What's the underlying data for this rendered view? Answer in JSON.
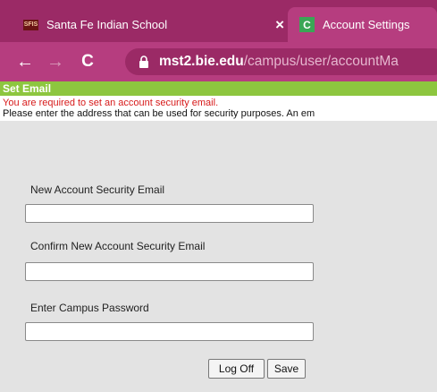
{
  "browser": {
    "tabs": [
      {
        "favicon_text": "SFIS",
        "title": "Santa Fe Indian School",
        "close_glyph": "×"
      },
      {
        "favicon_text": "C",
        "title": "Account Settings"
      }
    ],
    "nav": {
      "back_icon": "←",
      "forward_icon": "→",
      "reload_icon": "C"
    },
    "url_host": "mst2.bie.edu",
    "url_path": "/campus/user/accountMa"
  },
  "page": {
    "header": "Set Email",
    "error_message": "You are required to set an account security email.",
    "info_message": "Please enter the address that can be used for security purposes. An em",
    "fields": [
      {
        "label": "New Account Security Email",
        "value": ""
      },
      {
        "label": "Confirm New Account Security Email",
        "value": ""
      },
      {
        "label": "Enter Campus Password",
        "value": ""
      }
    ],
    "buttons": {
      "logoff": "Log Off",
      "save": "Save"
    }
  },
  "colors": {
    "browser_frame": "#9b2a66",
    "active_tab": "#b63d7f",
    "header_green": "#8dc63f",
    "error_red": "#d71a1a"
  }
}
